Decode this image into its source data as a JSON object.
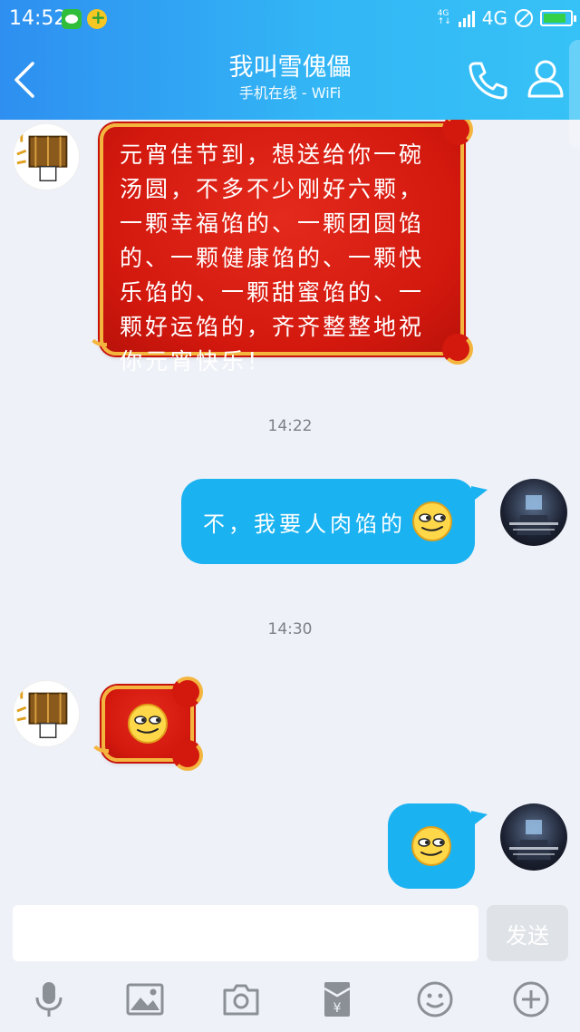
{
  "status_bar": {
    "time": "14:52",
    "network_small_top": "4G",
    "network_small_bottom": "↑↓",
    "network": "4G"
  },
  "header": {
    "title": "我叫雪傀儡",
    "subtitle": "手机在线 - WiFi",
    "back_icon": "chevron-left-icon",
    "call_icon": "phone-icon",
    "profile_icon": "person-icon"
  },
  "messages": [
    {
      "from": "friend",
      "type": "greeting-card",
      "text": "元宵佳节到，想送给你一碗汤圆，不多不少刚好六颗，一颗幸福馅的、一颗团圆馅的、一颗健康馅的、一颗快乐馅的、一颗甜蜜馅的、一颗好运馅的，齐齐整整地祝你元宵快乐！"
    },
    {
      "type": "timestamp",
      "text": "14:22"
    },
    {
      "from": "me",
      "type": "text",
      "text": "不，我要人肉馅的",
      "emoji": "smirk-emoji"
    },
    {
      "type": "timestamp",
      "text": "14:30"
    },
    {
      "from": "friend",
      "type": "emoji",
      "emoji": "smirk-emoji"
    },
    {
      "from": "me",
      "type": "emoji",
      "emoji": "smirk-emoji"
    }
  ],
  "friend_avatar_text": "年味",
  "input": {
    "value": "",
    "placeholder": "",
    "send_label": "发送"
  },
  "toolbar": [
    {
      "icon": "microphone-icon"
    },
    {
      "icon": "image-icon"
    },
    {
      "icon": "camera-icon"
    },
    {
      "icon": "red-packet-icon"
    },
    {
      "icon": "emoji-icon"
    },
    {
      "icon": "plus-icon"
    }
  ],
  "colors": {
    "header_start": "#2e8ff0",
    "header_end": "#36c2f6",
    "my_bubble": "#1ab2f1",
    "card_red": "#d3180e",
    "card_gold": "#f4b53f",
    "background": "#eef1f7"
  }
}
